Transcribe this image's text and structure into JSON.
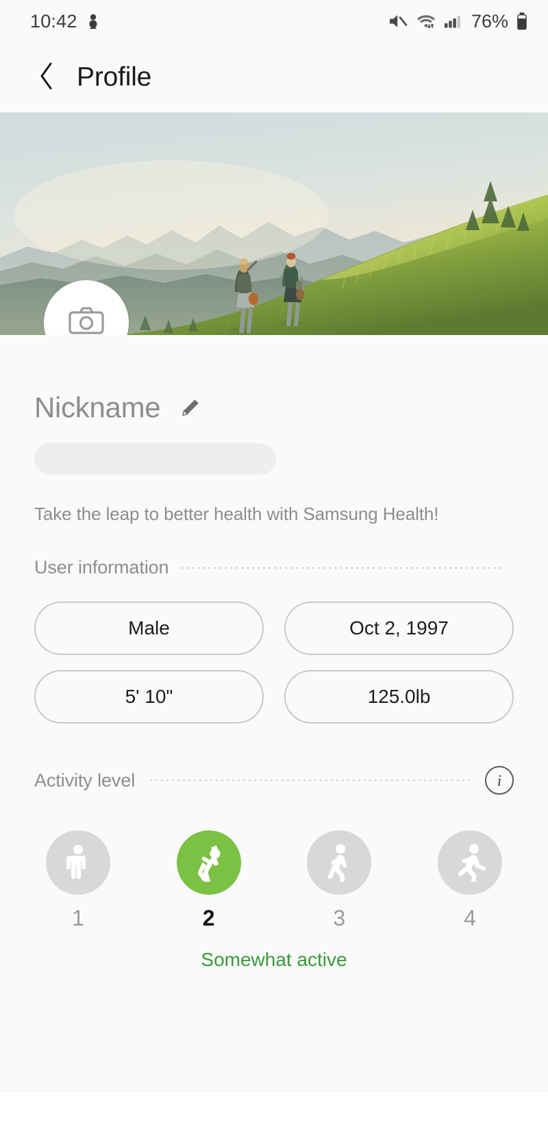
{
  "status_bar": {
    "time": "10:42",
    "battery_percent": "76%",
    "icons": [
      "alarm-icon",
      "mute-icon",
      "wifi-icon",
      "cellular-signal-icon",
      "battery-icon"
    ]
  },
  "app_bar": {
    "back_label": "back-icon",
    "title": "Profile"
  },
  "hero": {
    "alt": "two hikers walking up a grassy mountain slope at sunset",
    "avatar_icon": "camera-icon"
  },
  "profile": {
    "nickname_placeholder": "Nickname",
    "nickname_value": "",
    "edit_icon": "pencil-icon",
    "tagline": "Take the leap to better health with Samsung Health!"
  },
  "user_information": {
    "section_title": "User information",
    "chips": [
      {
        "name": "gender",
        "value": "Male"
      },
      {
        "name": "birthday",
        "value": "Oct 2, 1997"
      },
      {
        "name": "height",
        "value": "5' 10\""
      },
      {
        "name": "weight",
        "value": "125.0lb"
      }
    ]
  },
  "activity_level": {
    "section_title": "Activity level",
    "info_icon": "info-icon",
    "info_glyph": "i",
    "selected_index": 1,
    "levels": [
      {
        "number": "1",
        "icon": "standing-person-icon",
        "selected": false
      },
      {
        "number": "2",
        "icon": "stretching-person-icon",
        "selected": true
      },
      {
        "number": "3",
        "icon": "walking-person-icon",
        "selected": false
      },
      {
        "number": "4",
        "icon": "running-person-icon",
        "selected": false
      }
    ],
    "caption": "Somewhat active"
  },
  "colors": {
    "accent_green": "#7bc143",
    "caption_green": "#3a9a3a",
    "page_bg": "#fafafa",
    "muted_text": "#8d8d8d"
  }
}
